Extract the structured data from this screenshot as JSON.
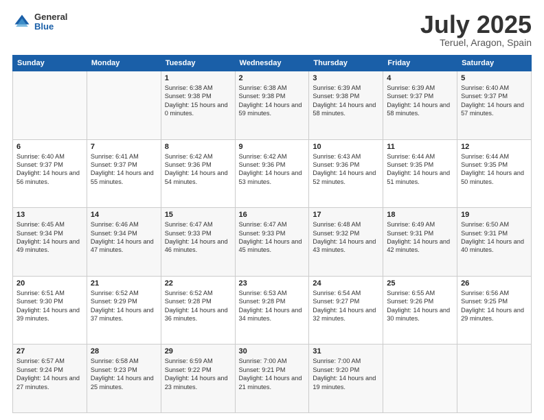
{
  "header": {
    "logo": {
      "general": "General",
      "blue": "Blue"
    },
    "title": "July 2025",
    "location": "Teruel, Aragon, Spain"
  },
  "weekdays": [
    "Sunday",
    "Monday",
    "Tuesday",
    "Wednesday",
    "Thursday",
    "Friday",
    "Saturday"
  ],
  "weeks": [
    [
      {
        "day": "",
        "detail": ""
      },
      {
        "day": "",
        "detail": ""
      },
      {
        "day": "1",
        "detail": "Sunrise: 6:38 AM\nSunset: 9:38 PM\nDaylight: 15 hours\nand 0 minutes."
      },
      {
        "day": "2",
        "detail": "Sunrise: 6:38 AM\nSunset: 9:38 PM\nDaylight: 14 hours\nand 59 minutes."
      },
      {
        "day": "3",
        "detail": "Sunrise: 6:39 AM\nSunset: 9:38 PM\nDaylight: 14 hours\nand 58 minutes."
      },
      {
        "day": "4",
        "detail": "Sunrise: 6:39 AM\nSunset: 9:37 PM\nDaylight: 14 hours\nand 58 minutes."
      },
      {
        "day": "5",
        "detail": "Sunrise: 6:40 AM\nSunset: 9:37 PM\nDaylight: 14 hours\nand 57 minutes."
      }
    ],
    [
      {
        "day": "6",
        "detail": "Sunrise: 6:40 AM\nSunset: 9:37 PM\nDaylight: 14 hours\nand 56 minutes."
      },
      {
        "day": "7",
        "detail": "Sunrise: 6:41 AM\nSunset: 9:37 PM\nDaylight: 14 hours\nand 55 minutes."
      },
      {
        "day": "8",
        "detail": "Sunrise: 6:42 AM\nSunset: 9:36 PM\nDaylight: 14 hours\nand 54 minutes."
      },
      {
        "day": "9",
        "detail": "Sunrise: 6:42 AM\nSunset: 9:36 PM\nDaylight: 14 hours\nand 53 minutes."
      },
      {
        "day": "10",
        "detail": "Sunrise: 6:43 AM\nSunset: 9:36 PM\nDaylight: 14 hours\nand 52 minutes."
      },
      {
        "day": "11",
        "detail": "Sunrise: 6:44 AM\nSunset: 9:35 PM\nDaylight: 14 hours\nand 51 minutes."
      },
      {
        "day": "12",
        "detail": "Sunrise: 6:44 AM\nSunset: 9:35 PM\nDaylight: 14 hours\nand 50 minutes."
      }
    ],
    [
      {
        "day": "13",
        "detail": "Sunrise: 6:45 AM\nSunset: 9:34 PM\nDaylight: 14 hours\nand 49 minutes."
      },
      {
        "day": "14",
        "detail": "Sunrise: 6:46 AM\nSunset: 9:34 PM\nDaylight: 14 hours\nand 47 minutes."
      },
      {
        "day": "15",
        "detail": "Sunrise: 6:47 AM\nSunset: 9:33 PM\nDaylight: 14 hours\nand 46 minutes."
      },
      {
        "day": "16",
        "detail": "Sunrise: 6:47 AM\nSunset: 9:33 PM\nDaylight: 14 hours\nand 45 minutes."
      },
      {
        "day": "17",
        "detail": "Sunrise: 6:48 AM\nSunset: 9:32 PM\nDaylight: 14 hours\nand 43 minutes."
      },
      {
        "day": "18",
        "detail": "Sunrise: 6:49 AM\nSunset: 9:31 PM\nDaylight: 14 hours\nand 42 minutes."
      },
      {
        "day": "19",
        "detail": "Sunrise: 6:50 AM\nSunset: 9:31 PM\nDaylight: 14 hours\nand 40 minutes."
      }
    ],
    [
      {
        "day": "20",
        "detail": "Sunrise: 6:51 AM\nSunset: 9:30 PM\nDaylight: 14 hours\nand 39 minutes."
      },
      {
        "day": "21",
        "detail": "Sunrise: 6:52 AM\nSunset: 9:29 PM\nDaylight: 14 hours\nand 37 minutes."
      },
      {
        "day": "22",
        "detail": "Sunrise: 6:52 AM\nSunset: 9:28 PM\nDaylight: 14 hours\nand 36 minutes."
      },
      {
        "day": "23",
        "detail": "Sunrise: 6:53 AM\nSunset: 9:28 PM\nDaylight: 14 hours\nand 34 minutes."
      },
      {
        "day": "24",
        "detail": "Sunrise: 6:54 AM\nSunset: 9:27 PM\nDaylight: 14 hours\nand 32 minutes."
      },
      {
        "day": "25",
        "detail": "Sunrise: 6:55 AM\nSunset: 9:26 PM\nDaylight: 14 hours\nand 30 minutes."
      },
      {
        "day": "26",
        "detail": "Sunrise: 6:56 AM\nSunset: 9:25 PM\nDaylight: 14 hours\nand 29 minutes."
      }
    ],
    [
      {
        "day": "27",
        "detail": "Sunrise: 6:57 AM\nSunset: 9:24 PM\nDaylight: 14 hours\nand 27 minutes."
      },
      {
        "day": "28",
        "detail": "Sunrise: 6:58 AM\nSunset: 9:23 PM\nDaylight: 14 hours\nand 25 minutes."
      },
      {
        "day": "29",
        "detail": "Sunrise: 6:59 AM\nSunset: 9:22 PM\nDaylight: 14 hours\nand 23 minutes."
      },
      {
        "day": "30",
        "detail": "Sunrise: 7:00 AM\nSunset: 9:21 PM\nDaylight: 14 hours\nand 21 minutes."
      },
      {
        "day": "31",
        "detail": "Sunrise: 7:00 AM\nSunset: 9:20 PM\nDaylight: 14 hours\nand 19 minutes."
      },
      {
        "day": "",
        "detail": ""
      },
      {
        "day": "",
        "detail": ""
      }
    ]
  ]
}
